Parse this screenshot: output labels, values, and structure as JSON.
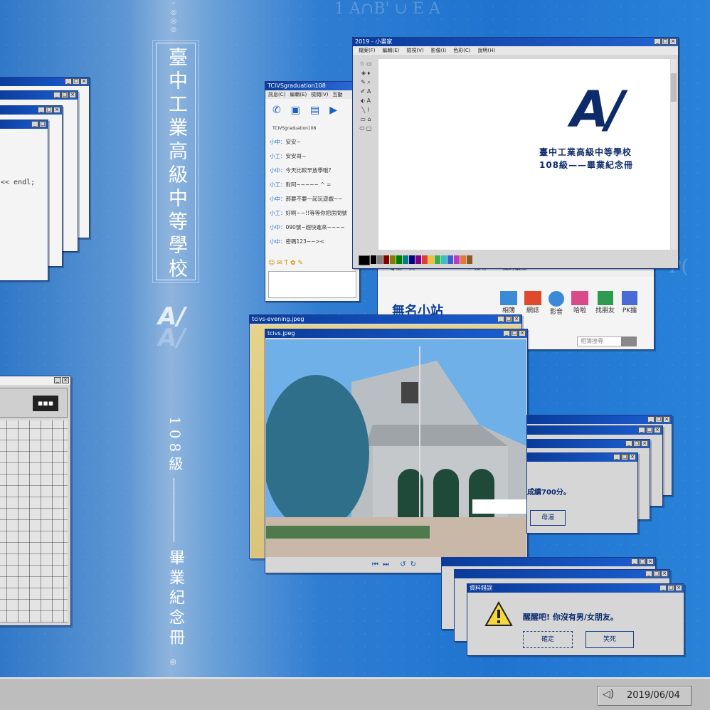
{
  "vertical_title": "臺中工業高級中等學校",
  "logo_text": "A/",
  "class_text": "108級",
  "book_text": "畢業紀念冊",
  "chat": {
    "title": "TCIVSgraduation108",
    "menu": [
      "訊息(C)",
      "編輯(E)",
      "檢閱(V)",
      "互動"
    ],
    "contact": "TCIVSgraduation108",
    "lines": [
      {
        "name": "小中：",
        "text": "安安~"
      },
      {
        "name": "小工：",
        "text": "安安哥~"
      },
      {
        "name": "小中：",
        "text": "今天比較早放學哦?"
      },
      {
        "name": "小工：",
        "text": "對阿~~~~~ ^ =  "
      },
      {
        "name": "小中：",
        "text": "那要不要一起玩遊戲~~"
      },
      {
        "name": "小工：",
        "text": "好啊~~!!等等你把房間號"
      },
      {
        "name": "小中：",
        "text": "090號~趕快進來~~~~"
      },
      {
        "name": "小中：",
        "text": "密碼123~~>< "
      }
    ]
  },
  "paint": {
    "title": "2019 - 小畫家",
    "menu": [
      "檔案(F)",
      "編輯(E)",
      "檢視(V)",
      "影像(I)",
      "色彩(C)",
      "說明(H)"
    ],
    "canvas_logo": "A/",
    "canvas_line1": "臺中工業高級中等學校",
    "canvas_line2": "108級——畢業紀念冊"
  },
  "browser": {
    "back_label": "上一頁",
    "search_label": "搜尋",
    "fav_label": "我的最愛",
    "site_name": "無名小站",
    "icons": [
      "相簿",
      "網誌",
      "影音",
      "哈啦",
      "找朋友",
      "PK擂"
    ],
    "search_placeholder": "相簿搜尋"
  },
  "photo_back": {
    "title": "tcivs-evening.jpeg"
  },
  "photo_front": {
    "title": "tcivs.jpeg"
  },
  "score_dialog": {
    "text": "成績700分。",
    "button": "母湯"
  },
  "alert": {
    "title": "資料錯誤",
    "message": "醒醒吧! 你沒有男/女朋友。",
    "ok": "確定",
    "cancel": "笑死"
  },
  "code_text": "<< endl;",
  "clock": {
    "date": "2019/06/04"
  },
  "colors": {
    "title_bar": "#0a3b9a",
    "background": "#1f74d0",
    "taskbar": "#bdbdbd"
  }
}
